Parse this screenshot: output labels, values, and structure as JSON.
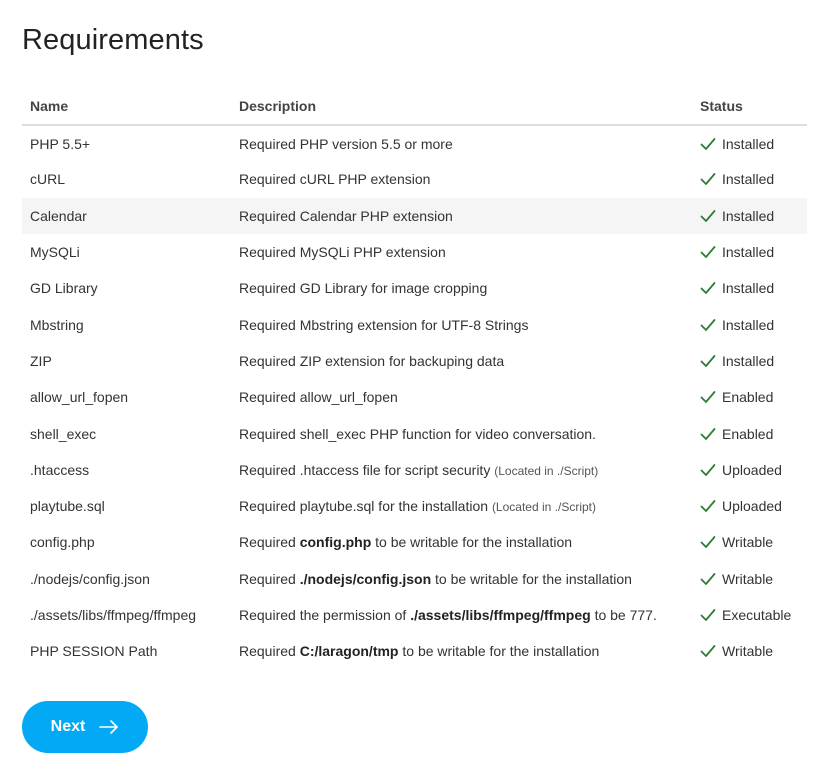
{
  "page": {
    "title": "Requirements"
  },
  "table": {
    "headers": {
      "name": "Name",
      "description": "Description",
      "status": "Status"
    },
    "rows": [
      {
        "name": "PHP 5.5+",
        "desc": [
          {
            "t": "Required PHP version 5.5 or more"
          }
        ],
        "status": "Installed"
      },
      {
        "name": "cURL",
        "desc": [
          {
            "t": "Required cURL PHP extension"
          }
        ],
        "status": "Installed"
      },
      {
        "name": "Calendar",
        "desc": [
          {
            "t": "Required Calendar PHP extension"
          }
        ],
        "status": "Installed"
      },
      {
        "name": "MySQLi",
        "desc": [
          {
            "t": "Required MySQLi PHP extension"
          }
        ],
        "status": "Installed"
      },
      {
        "name": "GD Library",
        "desc": [
          {
            "t": "Required GD Library for image cropping"
          }
        ],
        "status": "Installed"
      },
      {
        "name": "Mbstring",
        "desc": [
          {
            "t": "Required Mbstring extension for UTF-8 Strings"
          }
        ],
        "status": "Installed"
      },
      {
        "name": "ZIP",
        "desc": [
          {
            "t": "Required ZIP extension for backuping data"
          }
        ],
        "status": "Installed"
      },
      {
        "name": "allow_url_fopen",
        "desc": [
          {
            "t": "Required allow_url_fopen"
          }
        ],
        "status": "Enabled"
      },
      {
        "name": "shell_exec",
        "desc": [
          {
            "t": "Required shell_exec PHP function for video conversation."
          }
        ],
        "status": "Enabled"
      },
      {
        "name": ".htaccess",
        "desc": [
          {
            "t": "Required .htaccess file for script security "
          },
          {
            "t": "(Located in ./Script)",
            "s": "note"
          }
        ],
        "status": "Uploaded"
      },
      {
        "name": "playtube.sql",
        "desc": [
          {
            "t": "Required playtube.sql for the installation "
          },
          {
            "t": "(Located in ./Script)",
            "s": "note"
          }
        ],
        "status": "Uploaded"
      },
      {
        "name": "config.php",
        "desc": [
          {
            "t": "Required "
          },
          {
            "t": "config.php",
            "s": "strong"
          },
          {
            "t": " to be writable for the installation"
          }
        ],
        "status": "Writable"
      },
      {
        "name": "./nodejs/config.json",
        "desc": [
          {
            "t": "Required "
          },
          {
            "t": "./nodejs/config.json",
            "s": "strong"
          },
          {
            "t": " to be writable for the installation"
          }
        ],
        "status": "Writable"
      },
      {
        "name": "./assets/libs/ffmpeg/ffmpeg",
        "desc": [
          {
            "t": "Required the permission of "
          },
          {
            "t": "./assets/libs/ffmpeg/ffmpeg",
            "s": "strong"
          },
          {
            "t": " to be 777."
          }
        ],
        "status": "Executable"
      },
      {
        "name": "PHP SESSION Path",
        "desc": [
          {
            "t": "Required "
          },
          {
            "t": "C:/laragon/tmp",
            "s": "strong"
          },
          {
            "t": " to be writable for the installation"
          }
        ],
        "status": "Writable"
      }
    ],
    "hover_row_index": 2
  },
  "next_button": {
    "label": "Next",
    "icon": "arrow-right-icon"
  },
  "colors": {
    "accent": "#03a9f4",
    "status_ok": "#2e7d32",
    "hover_row": "#f5f5f5",
    "header_border": "#dcdcdc"
  },
  "status_icon": "check-icon"
}
